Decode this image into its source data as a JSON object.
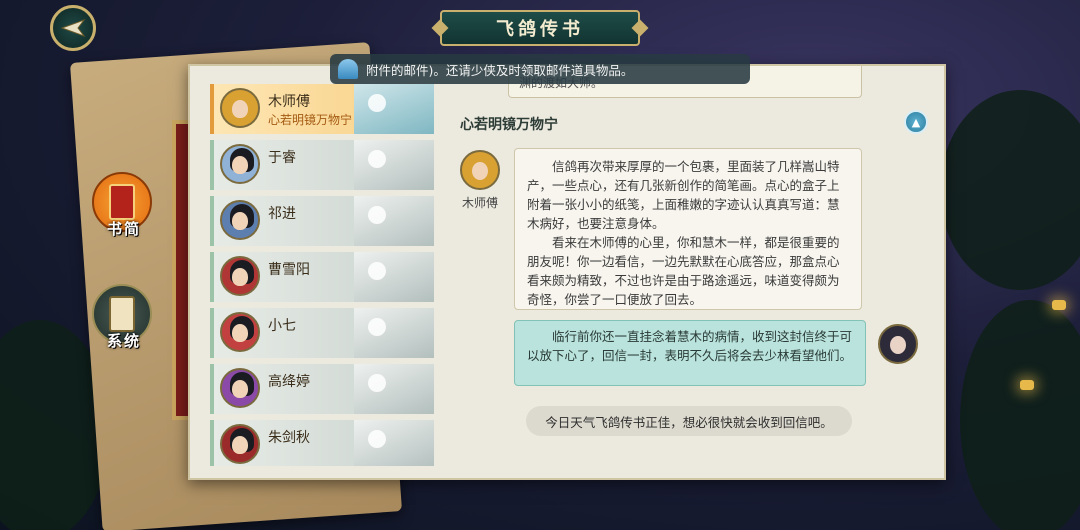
{
  "title": "飞鸽传书",
  "side_tabs": [
    {
      "label": "书简"
    },
    {
      "label": "系统"
    }
  ],
  "toast": {
    "text": "附件的邮件)。还请少侠及时领取邮件道具物品。"
  },
  "contacts": [
    {
      "name": "木师傅",
      "subtitle": "心若明镜万物宁",
      "active": true
    },
    {
      "name": "于睿",
      "subtitle": ""
    },
    {
      "name": "祁进",
      "subtitle": ""
    },
    {
      "name": "曹雪阳",
      "subtitle": ""
    },
    {
      "name": "小七",
      "subtitle": ""
    },
    {
      "name": "高绛婷",
      "subtitle": ""
    },
    {
      "name": "朱剑秋",
      "subtitle": ""
    }
  ],
  "chat": {
    "top_fragment": "渊的渡如大师。",
    "section_title": "心若明镜万物宁",
    "sender_name": "木师傅",
    "incoming_paragraph_1": "信鸽再次带来厚厚的一个包裹，里面装了几样嵩山特产，一些点心，还有几张新创作的简笔画。点心的盒子上附着一张小小的纸笺，上面稚嫩的字迹认认真真写道：慧木病好，也要注意身体。",
    "incoming_paragraph_2": "看来在木师傅的心里，你和慧木一样，都是很重要的朋友呢！你一边看信，一边先默默在心底答应，那盒点心看来颇为精致，不过也许是由于路途遥远，味道变得颇为奇怪，你尝了一口便放了回去。",
    "outgoing": "临行前你还一直挂念着慧木的病情，收到这封信终于可以放下心了，回信一封，表明不久后将会去少林看望他们。",
    "system_note": "今日天气飞鸽传书正佳，想必很快就会收到回信吧。"
  }
}
